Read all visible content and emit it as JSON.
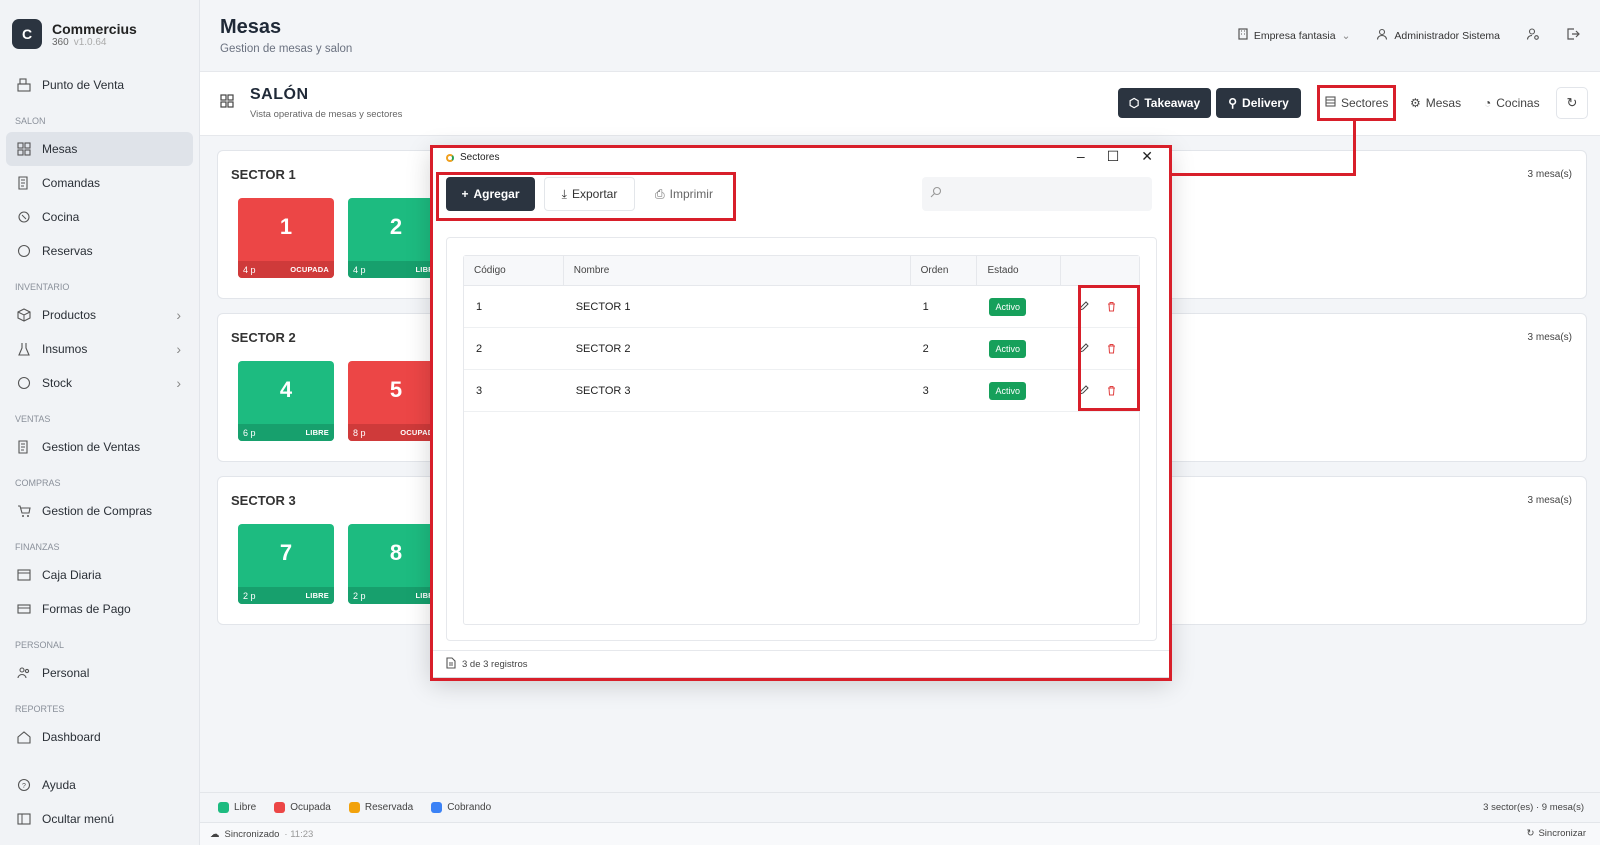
{
  "app": {
    "name": "Commercius",
    "edition": "360",
    "version": "v1.0.64",
    "logo_letter": "C"
  },
  "sidebar": {
    "items": [
      {
        "label": "Punto de Venta",
        "icon": "cash-register-icon"
      },
      {
        "section": "SALON"
      },
      {
        "label": "Mesas",
        "icon": "grid-icon",
        "active": true
      },
      {
        "label": "Comandas",
        "icon": "receipt-icon"
      },
      {
        "label": "Cocina",
        "icon": "chef-icon"
      },
      {
        "label": "Reservas",
        "icon": "circle-icon"
      },
      {
        "section": "INVENTARIO"
      },
      {
        "label": "Productos",
        "icon": "box-icon",
        "submenu": true
      },
      {
        "label": "Insumos",
        "icon": "flask-icon",
        "submenu": true
      },
      {
        "label": "Stock",
        "icon": "circle-icon",
        "submenu": true
      },
      {
        "section": "VENTAS"
      },
      {
        "label": "Gestion de Ventas",
        "icon": "receipt-icon"
      },
      {
        "section": "COMPRAS"
      },
      {
        "label": "Gestion de Compras",
        "icon": "cart-icon"
      },
      {
        "section": "FINANZAS"
      },
      {
        "label": "Caja Diaria",
        "icon": "register-icon"
      },
      {
        "label": "Formas de Pago",
        "icon": "card-icon"
      },
      {
        "section": "PERSONAL"
      },
      {
        "label": "Personal",
        "icon": "users-icon"
      },
      {
        "section": "REPORTES"
      },
      {
        "label": "Dashboard",
        "icon": "home-icon"
      }
    ],
    "bottom": [
      {
        "label": "Ayuda",
        "icon": "help-icon"
      },
      {
        "label": "Ocultar menú",
        "icon": "collapse-icon"
      }
    ]
  },
  "header": {
    "title": "Mesas",
    "subtitle": "Gestion de mesas y salon",
    "company": "Empresa fantasia",
    "user": "Administrador Sistema"
  },
  "subheader": {
    "title": "SALÓN",
    "subtitle": "Vista operativa de mesas y sectores",
    "buttons": {
      "takeaway": "Takeaway",
      "delivery": "Delivery",
      "sectores": "Sectores",
      "mesas": "Mesas",
      "cocinas": "Cocinas"
    }
  },
  "sectors": [
    {
      "name": "SECTOR 1",
      "count": "3  mesa(s)",
      "tables": [
        {
          "num": "1",
          "people": "4 p",
          "status": "OCUPADA",
          "state": "ocupada"
        },
        {
          "num": "2",
          "people": "4 p",
          "status": "LIBRE",
          "state": "libre"
        }
      ]
    },
    {
      "name": "SECTOR 2",
      "count": "3  mesa(s)",
      "tables": [
        {
          "num": "4",
          "people": "6 p",
          "status": "LIBRE",
          "state": "libre"
        },
        {
          "num": "5",
          "people": "8 p",
          "status": "OCUPADA",
          "state": "ocupada"
        }
      ]
    },
    {
      "name": "SECTOR 3",
      "count": "3  mesa(s)",
      "tables": [
        {
          "num": "7",
          "people": "2 p",
          "status": "LIBRE",
          "state": "libre"
        },
        {
          "num": "8",
          "people": "2 p",
          "status": "LIBRE",
          "state": "libre"
        }
      ]
    }
  ],
  "legend": {
    "items": [
      {
        "label": "Libre",
        "color": "#1dbb80"
      },
      {
        "label": "Ocupada",
        "color": "#ec4646"
      },
      {
        "label": "Reservada",
        "color": "#f2a20c"
      },
      {
        "label": "Cobrando",
        "color": "#3b82f6"
      }
    ],
    "summary": "3 sector(es) · 9 mesa(s)"
  },
  "statusbar": {
    "sync": "Sincronizado",
    "time": "· 11:23",
    "right": "Sincronizar"
  },
  "modal": {
    "title": "Sectores",
    "toolbar": {
      "add": "Agregar",
      "export": "Exportar",
      "print": "Imprimir"
    },
    "search_placeholder": "",
    "columns": {
      "codigo": "Código",
      "nombre": "Nombre",
      "orden": "Orden",
      "estado": "Estado"
    },
    "rows": [
      {
        "codigo": "1",
        "nombre": "SECTOR 1",
        "orden": "1",
        "estado": "Activo"
      },
      {
        "codigo": "2",
        "nombre": "SECTOR 2",
        "orden": "2",
        "estado": "Activo"
      },
      {
        "codigo": "3",
        "nombre": "SECTOR 3",
        "orden": "3",
        "estado": "Activo"
      }
    ],
    "footer": "3 de 3 registros"
  },
  "colors": {
    "accent_dark": "#2b3440",
    "highlight": "#d81f2a",
    "active_badge": "#16a05b"
  }
}
